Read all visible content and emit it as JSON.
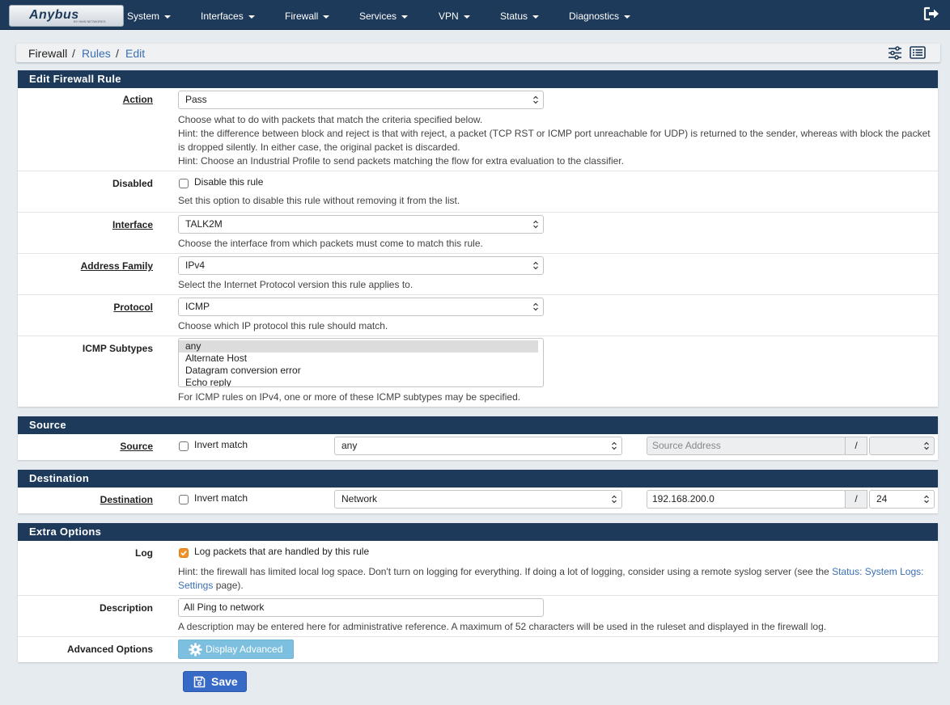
{
  "navbar": {
    "logo": "Anybus",
    "logo_sub": "BY HMS NETWORKS",
    "items": [
      "System",
      "Interfaces",
      "Firewall",
      "Services",
      "VPN",
      "Status",
      "Diagnostics"
    ],
    "logout_icon": "sign-out-icon"
  },
  "breadcrumb": {
    "root": "Firewall",
    "sep": "/",
    "rules": "Rules",
    "edit": "Edit",
    "icons": [
      "sliders-icon",
      "list-icon"
    ]
  },
  "edit_rule": {
    "heading": "Edit Firewall Rule",
    "action": {
      "label": "Action",
      "value": "Pass",
      "help": [
        "Choose what to do with packets that match the criteria specified below.",
        "Hint: the difference between block and reject is that with reject, a packet (TCP RST or ICMP port unreachable for UDP) is returned to the sender, whereas with block the packet is dropped silently. In either case, the original packet is discarded.",
        "Hint: Choose an Industrial Profile to send packets matching the flow for extra evaluation to the classifier."
      ]
    },
    "disabled": {
      "label": "Disabled",
      "checkbox_label": "Disable this rule",
      "checked": false,
      "help": "Set this option to disable this rule without removing it from the list."
    },
    "interface": {
      "label": "Interface",
      "value": "TALK2M",
      "help": "Choose the interface from which packets must come to match this rule."
    },
    "address_family": {
      "label": "Address Family",
      "value": "IPv4",
      "help": "Select the Internet Protocol version this rule applies to."
    },
    "protocol": {
      "label": "Protocol",
      "value": "ICMP",
      "help": "Choose which IP protocol this rule should match."
    },
    "icmp_subtypes": {
      "label": "ICMP Subtypes",
      "options": [
        "any",
        "Alternate Host",
        "Datagram conversion error",
        "Echo reply"
      ],
      "selected": "any",
      "help": "For ICMP rules on IPv4, one or more of these ICMP subtypes may be specified."
    }
  },
  "source": {
    "heading": "Source",
    "label": "Source",
    "invert_label": "Invert match",
    "invert_checked": false,
    "type": "any",
    "address_placeholder": "Source Address",
    "slash": "/",
    "mask": ""
  },
  "destination": {
    "heading": "Destination",
    "label": "Destination",
    "invert_label": "Invert match",
    "invert_checked": false,
    "type": "Network",
    "address": "192.168.200.0",
    "slash": "/",
    "mask": "24"
  },
  "extra": {
    "heading": "Extra Options",
    "log": {
      "label": "Log",
      "checkbox_label": "Log packets that are handled by this rule",
      "checked": true,
      "help_pre": "Hint: the firewall has limited local log space. Don't turn on logging for everything. If doing a lot of logging, consider using a remote syslog server (see the ",
      "help_link": "Status: System Logs: Settings",
      "help_post": " page)."
    },
    "description": {
      "label": "Description",
      "value": "All Ping to network",
      "help": "A description may be entered here for administrative reference. A maximum of 52 characters will be used in the ruleset and displayed in the firewall log."
    },
    "advanced": {
      "label": "Advanced Options",
      "button": "Display Advanced"
    }
  },
  "save_button": "Save",
  "colors": {
    "navbar": "#1e3a5a",
    "link": "#3a6fb5",
    "save": "#3769c6",
    "advanced": "#7dbfdf",
    "checkbox_on": "#f0922a"
  }
}
